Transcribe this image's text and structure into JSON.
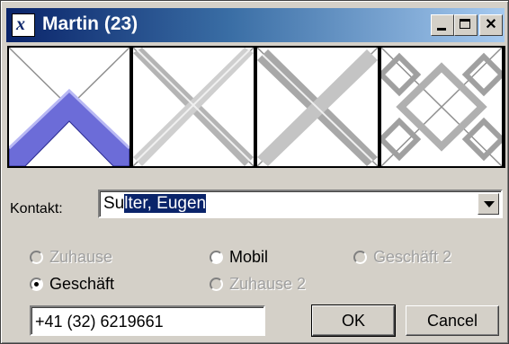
{
  "window": {
    "title": "Martin (23)",
    "app_icon": "app-logo-icon"
  },
  "titlebar_buttons": {
    "minimize_icon": "minimize-icon",
    "maximize_icon": "maximize-icon",
    "close_icon": "close-icon"
  },
  "contact": {
    "label": "Kontakt:",
    "value_prefix": "Su",
    "value_selected": "lter, Eugen",
    "dropdown_icon": "chevron-down-icon"
  },
  "radios": {
    "zuhause": "Zuhause",
    "mobil": "Mobil",
    "geschaeft2": "Geschäft 2",
    "geschaeft": "Geschäft",
    "zuhause2": "Zuhause 2"
  },
  "phone": {
    "value": "+41 (32) 6219661"
  },
  "buttons": {
    "ok": "OK",
    "cancel": "Cancel"
  }
}
